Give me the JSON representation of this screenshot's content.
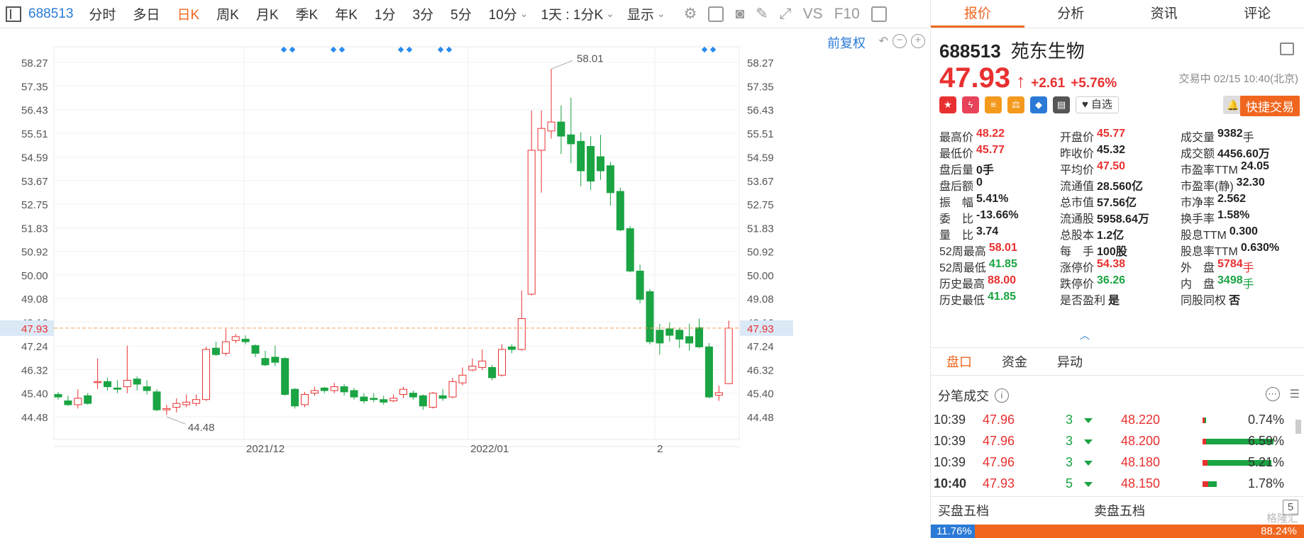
{
  "toolbar": {
    "code": "688513",
    "items": [
      "分时",
      "多日",
      "日K",
      "周K",
      "月K",
      "季K",
      "年K",
      "1分",
      "3分",
      "5分",
      "10分"
    ],
    "active": "日K",
    "interval_select": "1天 : 1分K",
    "display_label": "显示",
    "vs_label": "VS",
    "f10_label": "F10"
  },
  "chart_header": {
    "adjust_label": "前复权"
  },
  "chart_data": {
    "type": "candlestick",
    "y_ticks": [
      "58.27",
      "57.35",
      "56.43",
      "55.51",
      "54.59",
      "53.67",
      "52.75",
      "51.83",
      "50.92",
      "50.00",
      "49.08",
      "48.16",
      "47.24",
      "46.32",
      "45.40",
      "44.48"
    ],
    "current_price_label": "47.93",
    "current_price": 47.93,
    "x_labels": [
      "2021/12",
      "2022/01",
      "2"
    ],
    "annotations": {
      "high": "58.01",
      "low": "44.48"
    },
    "high_value": 58.01,
    "low_value": 44.48,
    "ylim": [
      44.0,
      58.6
    ],
    "candles": [
      [
        45.35,
        45.25,
        45.45,
        45.15
      ],
      [
        45.1,
        44.95,
        45.3,
        44.9
      ],
      [
        44.95,
        45.2,
        45.55,
        44.8
      ],
      [
        45.3,
        45.0,
        45.4,
        44.95
      ],
      [
        45.85,
        45.85,
        46.75,
        45.55
      ],
      [
        45.85,
        45.65,
        46.0,
        45.5
      ],
      [
        45.6,
        45.55,
        45.9,
        45.4
      ],
      [
        45.65,
        45.9,
        47.25,
        45.4
      ],
      [
        45.95,
        45.75,
        46.05,
        45.5
      ],
      [
        45.65,
        45.5,
        45.9,
        45.35
      ],
      [
        45.45,
        44.75,
        45.55,
        44.7
      ],
      [
        44.75,
        44.8,
        44.95,
        44.55
      ],
      [
        44.85,
        45.0,
        45.2,
        44.65
      ],
      [
        44.95,
        45.05,
        45.35,
        44.85
      ],
      [
        45.0,
        45.15,
        45.35,
        44.9
      ],
      [
        45.15,
        47.1,
        47.2,
        45.1
      ],
      [
        47.15,
        46.9,
        47.4,
        46.85
      ],
      [
        46.95,
        47.4,
        47.9,
        46.85
      ],
      [
        47.45,
        47.6,
        47.7,
        47.35
      ],
      [
        47.5,
        47.4,
        47.65,
        47.3
      ],
      [
        47.25,
        46.95,
        47.3,
        46.8
      ],
      [
        46.75,
        46.5,
        47.05,
        46.45
      ],
      [
        46.8,
        46.6,
        47.25,
        46.45
      ],
      [
        46.75,
        45.35,
        46.8,
        45.3
      ],
      [
        45.55,
        44.9,
        45.6,
        44.8
      ],
      [
        44.95,
        45.35,
        45.45,
        44.85
      ],
      [
        45.4,
        45.5,
        45.65,
        45.3
      ],
      [
        45.6,
        45.5,
        45.65,
        45.4
      ],
      [
        45.5,
        45.65,
        45.8,
        45.4
      ],
      [
        45.65,
        45.45,
        45.75,
        45.3
      ],
      [
        45.5,
        45.25,
        45.6,
        45.15
      ],
      [
        45.25,
        45.1,
        45.4,
        45.0
      ],
      [
        45.2,
        45.15,
        45.4,
        45.05
      ],
      [
        45.15,
        45.05,
        45.3,
        44.95
      ],
      [
        45.1,
        45.2,
        45.35,
        45.05
      ],
      [
        45.35,
        45.55,
        45.65,
        45.2
      ],
      [
        45.4,
        45.25,
        45.5,
        45.15
      ],
      [
        45.3,
        44.9,
        45.35,
        44.75
      ],
      [
        44.85,
        45.4,
        45.45,
        44.8
      ],
      [
        45.3,
        45.2,
        45.55,
        45.1
      ],
      [
        45.25,
        45.85,
        46.0,
        45.2
      ],
      [
        45.8,
        46.1,
        46.4,
        45.7
      ],
      [
        46.3,
        46.45,
        46.75,
        46.25
      ],
      [
        46.4,
        46.65,
        47.1,
        46.3
      ],
      [
        46.4,
        46.0,
        46.5,
        45.9
      ],
      [
        46.1,
        47.1,
        47.3,
        46.05
      ],
      [
        47.2,
        47.1,
        47.3,
        46.95
      ],
      [
        47.1,
        48.3,
        49.4,
        47.05
      ],
      [
        49.25,
        54.85,
        56.4,
        49.2
      ],
      [
        54.85,
        55.7,
        56.4,
        53.2
      ],
      [
        55.6,
        55.95,
        58.01,
        55.3
      ],
      [
        55.95,
        55.4,
        56.6,
        54.7
      ],
      [
        55.45,
        55.1,
        56.9,
        54.35
      ],
      [
        55.2,
        54.05,
        55.55,
        53.45
      ],
      [
        55.0,
        53.65,
        55.4,
        53.3
      ],
      [
        54.6,
        54.05,
        55.45,
        53.7
      ],
      [
        54.25,
        53.2,
        54.4,
        52.7
      ],
      [
        53.25,
        51.75,
        53.4,
        51.7
      ],
      [
        51.8,
        50.15,
        51.9,
        50.1
      ],
      [
        50.15,
        49.05,
        50.4,
        48.9
      ],
      [
        49.35,
        47.4,
        49.45,
        47.3
      ],
      [
        47.85,
        47.35,
        48.1,
        46.9
      ],
      [
        47.9,
        47.65,
        48.15,
        47.4
      ],
      [
        47.85,
        47.5,
        47.95,
        47.15
      ],
      [
        47.6,
        47.35,
        48.1,
        47.05
      ],
      [
        47.95,
        47.2,
        48.3,
        47.15
      ],
      [
        47.2,
        45.25,
        47.35,
        45.2
      ],
      [
        45.32,
        45.42,
        45.7,
        45.1
      ],
      [
        45.77,
        47.93,
        48.22,
        45.77
      ]
    ]
  },
  "quote": {
    "tabs": [
      "报价",
      "分析",
      "资讯",
      "评论"
    ],
    "active_tab": "报价",
    "code": "688513",
    "name": "苑东生物",
    "price": "47.93",
    "change": "+2.61",
    "change_pct": "+5.76%",
    "status": "交易中 02/15 10:40(北京)",
    "watch_label": "自选",
    "fast_trade_label": "快捷交易",
    "icon_colors": [
      "#e93030",
      "#e8435a",
      "#f39a1e",
      "#f39a1e",
      "#2a7ad6",
      "#555555"
    ],
    "icon_glyphs": [
      "★",
      "ϟ",
      "≡",
      "⚖",
      "◆",
      "▤"
    ],
    "fields": [
      [
        {
          "label": "最高价",
          "value": "48.22",
          "color": "red"
        },
        {
          "label": "开盘价",
          "value": "45.77",
          "color": "red"
        },
        {
          "label": "成交量",
          "value": "9382",
          "unit": "手",
          "color": ""
        }
      ],
      [
        {
          "label": "最低价",
          "value": "45.77",
          "color": "red"
        },
        {
          "label": "昨收价",
          "value": "45.32",
          "color": ""
        },
        {
          "label": "成交额",
          "value": "4456.60万",
          "color": ""
        }
      ],
      [
        {
          "label": "盘后量",
          "value": "0手",
          "color": ""
        },
        {
          "label": "平均价",
          "value": "47.50",
          "color": "red"
        },
        {
          "label": "市盈率TTM",
          "value": "24.05",
          "color": ""
        }
      ],
      [
        {
          "label": "盘后额",
          "value": "0",
          "color": ""
        },
        {
          "label": "流通值",
          "value": "28.560亿",
          "color": ""
        },
        {
          "label": "市盈率(静)",
          "value": "32.30",
          "color": ""
        }
      ],
      [
        {
          "label": "振　幅",
          "value": "5.41%",
          "color": ""
        },
        {
          "label": "总市值",
          "value": "57.56亿",
          "color": ""
        },
        {
          "label": "市净率",
          "value": "2.562",
          "color": ""
        }
      ],
      [
        {
          "label": "委　比",
          "value": "-13.66%",
          "color": ""
        },
        {
          "label": "流通股",
          "value": "5958.64万",
          "color": ""
        },
        {
          "label": "换手率",
          "value": "1.58%",
          "color": ""
        }
      ],
      [
        {
          "label": "量　比",
          "value": "3.74",
          "color": ""
        },
        {
          "label": "总股本",
          "value": "1.2亿",
          "color": ""
        },
        {
          "label": "股息TTM",
          "value": "0.300",
          "color": ""
        }
      ],
      [
        {
          "label": "52周最高",
          "value": "58.01",
          "color": "red"
        },
        {
          "label": "每　手",
          "value": "100股",
          "color": ""
        },
        {
          "label": "股息率TTM",
          "value": "0.630%",
          "color": ""
        }
      ],
      [
        {
          "label": "52周最低",
          "value": "41.85",
          "color": "green"
        },
        {
          "label": "涨停价",
          "value": "54.38",
          "color": "red"
        },
        {
          "label": "外　盘",
          "value": "5784",
          "unit": "手",
          "color": "red"
        }
      ],
      [
        {
          "label": "历史最高",
          "value": "88.00",
          "color": "red"
        },
        {
          "label": "跌停价",
          "value": "36.26",
          "color": "green"
        },
        {
          "label": "内　盘",
          "value": "3498",
          "unit": "手",
          "color": "green"
        }
      ],
      [
        {
          "label": "历史最低",
          "value": "41.85",
          "color": "green"
        },
        {
          "label": "是否盈利",
          "value": "是",
          "color": ""
        },
        {
          "label": "同股同权",
          "value": "否",
          "color": ""
        }
      ]
    ]
  },
  "subtabs": [
    "盘口",
    "资金",
    "异动"
  ],
  "active_subtab": "盘口",
  "ticks_title": "分笔成交",
  "ticks": [
    {
      "time": "10:39",
      "price": "47.96",
      "vol": "3",
      "p2": "48.220",
      "pct": "0.74%",
      "red_frac": 0.6,
      "green_frac": 0.4
    },
    {
      "time": "10:39",
      "price": "47.96",
      "vol": "3",
      "p2": "48.200",
      "pct": "6.59%",
      "red_frac": 0.14,
      "green_frac": 0.86
    },
    {
      "time": "10:39",
      "price": "47.96",
      "vol": "3",
      "p2": "48.180",
      "pct": "5.21%",
      "red_frac": 0.18,
      "green_frac": 0.82
    },
    {
      "time": "10:40",
      "price": "47.93",
      "vol": "5",
      "p2": "48.150",
      "pct": "1.78%",
      "red_frac": 0.35,
      "green_frac": 0.65
    }
  ],
  "depth": {
    "buy_label": "买盘五档",
    "sell_label": "卖盘五档",
    "buy_pct": "11.76%",
    "sell_pct": "88.24%",
    "level_badge": "5",
    "buy_frac": 0.1176
  },
  "watermark": "格隆汇"
}
